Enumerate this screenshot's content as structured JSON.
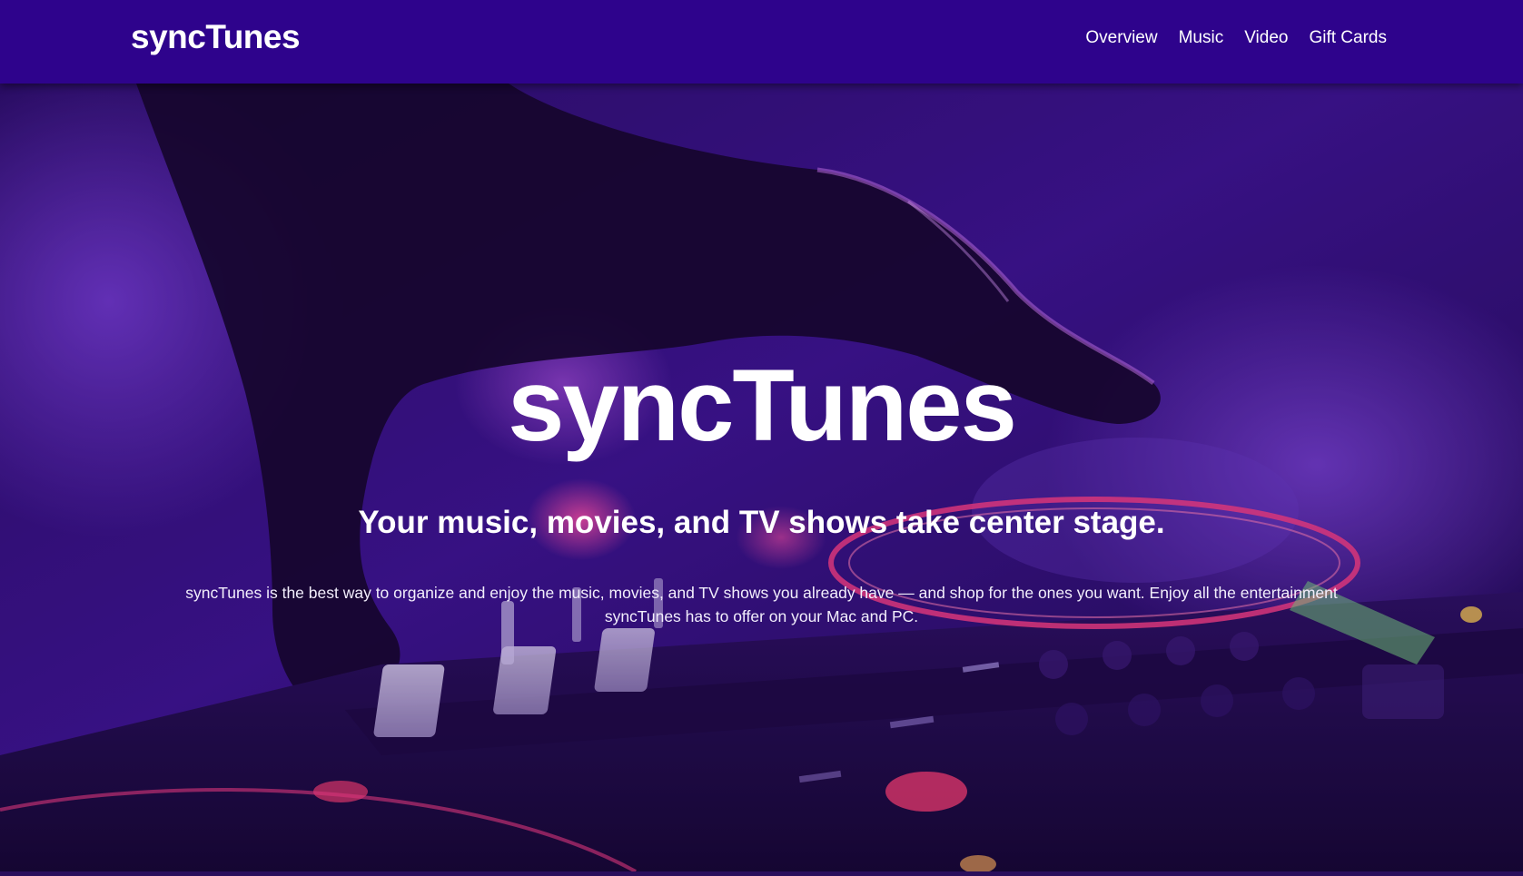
{
  "header": {
    "brand": "syncTunes",
    "nav": [
      {
        "label": "Overview"
      },
      {
        "label": "Music"
      },
      {
        "label": "Video"
      },
      {
        "label": "Gift Cards"
      }
    ]
  },
  "hero": {
    "title": "syncTunes",
    "subtitle": "Your music, movies, and TV shows take center stage.",
    "description": "syncTunes is the best way to organize and enjoy the music, movies, and TV shows you already have — and shop for the ones you want. Enjoy all the entertainment syncTunes has to offer on your Mac and PC."
  },
  "colors": {
    "navbar": "#2e038c",
    "text": "#ffffff",
    "hero_tint": "#3a0f8a"
  }
}
